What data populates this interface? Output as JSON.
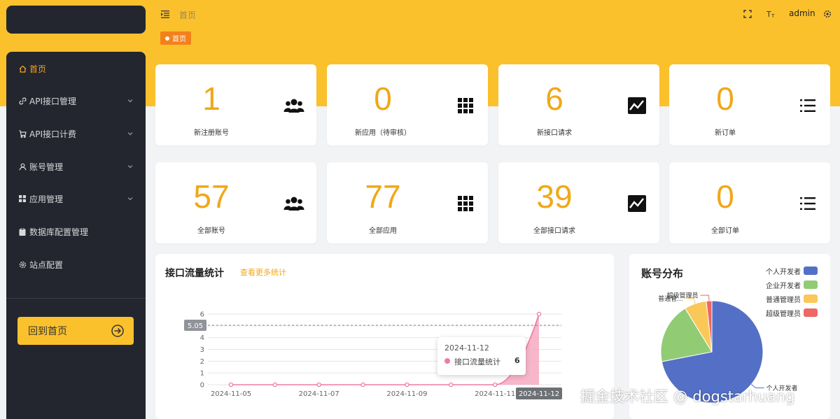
{
  "header": {
    "breadcrumb": "首页",
    "user": "admin",
    "tab": "首页"
  },
  "sidebar": {
    "items": [
      {
        "label": "首页",
        "icon": "home-icon",
        "active": true,
        "expandable": false
      },
      {
        "label": "API接口管理",
        "icon": "link-icon",
        "active": false,
        "expandable": true
      },
      {
        "label": "API接口计费",
        "icon": "cart-icon",
        "active": false,
        "expandable": true
      },
      {
        "label": "账号管理",
        "icon": "user-icon",
        "active": false,
        "expandable": true
      },
      {
        "label": "应用管理",
        "icon": "apps-icon",
        "active": false,
        "expandable": true
      },
      {
        "label": "数据库配置管理",
        "icon": "clipboard-icon",
        "active": false,
        "expandable": false
      },
      {
        "label": "站点配置",
        "icon": "gear-icon",
        "active": false,
        "expandable": false
      }
    ],
    "home_button": "回到首页"
  },
  "stats": [
    {
      "value": "1",
      "label": "新注册账号",
      "icon": "users-icon"
    },
    {
      "value": "0",
      "label": "新应用（待审核）",
      "icon": "grid-icon"
    },
    {
      "value": "6",
      "label": "新接口请求",
      "icon": "trend-icon"
    },
    {
      "value": "0",
      "label": "新订单",
      "icon": "list-icon"
    },
    {
      "value": "57",
      "label": "全部账号",
      "icon": "users-icon"
    },
    {
      "value": "77",
      "label": "全部应用",
      "icon": "grid-icon"
    },
    {
      "value": "39",
      "label": "全部接口请求",
      "icon": "trend-icon"
    },
    {
      "value": "0",
      "label": "全部订单",
      "icon": "list-icon"
    }
  ],
  "traffic": {
    "title": "接口流量统计",
    "more_link": "查看更多统计",
    "pointer_value": "5.05",
    "pointer_date": "2024-11-12",
    "tooltip": {
      "date": "2024-11-12",
      "series": "接口流量统计",
      "value": "6"
    }
  },
  "accounts": {
    "title": "账号分布"
  },
  "chart_data": [
    {
      "type": "area",
      "title": "接口流量统计",
      "x": [
        "2024-11-05",
        "2024-11-06",
        "2024-11-07",
        "2024-11-08",
        "2024-11-09",
        "2024-11-10",
        "2024-11-11",
        "2024-11-12"
      ],
      "xticks": [
        "2024-11-05",
        "2024-11-07",
        "2024-11-09",
        "2024-11-11"
      ],
      "yticks": [
        "0",
        "1",
        "2",
        "3",
        "4",
        "5",
        "6"
      ],
      "series": [
        {
          "name": "接口流量统计",
          "values": [
            0,
            0,
            0,
            0,
            0,
            0,
            0,
            6
          ]
        }
      ],
      "ylim": [
        0,
        6
      ],
      "grid": true,
      "colors": {
        "line": "#f07aa0",
        "fill": "#f7a9c1",
        "pointer": "#909399"
      }
    },
    {
      "type": "pie",
      "title": "账号分布",
      "slices": [
        {
          "name": "个人开发者",
          "label": "个人开发者",
          "value": 41,
          "color": "#5470c6"
        },
        {
          "name": "企业开发者",
          "label": "",
          "value": 11,
          "color": "#91cc75"
        },
        {
          "name": "普通管理员",
          "label": "普通管...",
          "value": 4,
          "color": "#fac858"
        },
        {
          "name": "超级管理员",
          "label": "超级管理员",
          "value": 1,
          "color": "#ee6666"
        }
      ],
      "legend": "top-right"
    }
  ],
  "watermark": "掘金技术社区 @ dogstarhuang"
}
